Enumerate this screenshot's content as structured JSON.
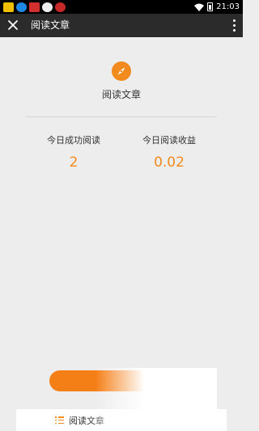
{
  "status_bar": {
    "time": "21:03"
  },
  "topbar": {
    "title": "阅读文章"
  },
  "header": {
    "section_title": "阅读文章",
    "accent_color": "#f28a1e"
  },
  "stats": [
    {
      "label": "今日成功阅读",
      "value": "2"
    },
    {
      "label": "今日阅读收益",
      "value": "0.02"
    }
  ],
  "bottom_nav": {
    "tab_label": "阅读文章"
  },
  "icons": [
    "close-icon",
    "more-icon",
    "compass-icon",
    "list-icon",
    "wifi-icon",
    "battery-icon"
  ]
}
